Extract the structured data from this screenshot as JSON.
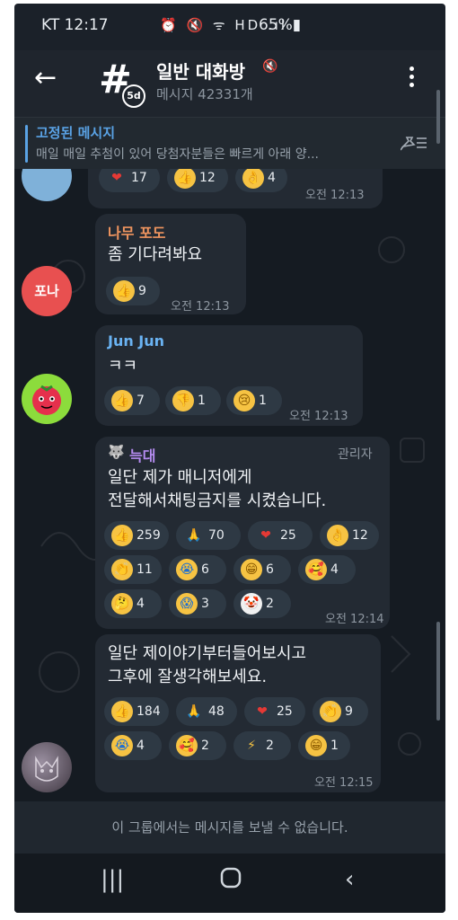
{
  "status": {
    "carrier_time": "KT 12:17",
    "icons": "⏰ 🔇 ᯤ HD .ıl",
    "battery": "65%▮"
  },
  "header": {
    "title": "일반 대화방",
    "badge": "5d",
    "subtitle": "메시지 42331개"
  },
  "pinned": {
    "title": "고정된 메시지",
    "text": "매일 매일 추첨이 있어 당첨자분들은 빠르게 아래 양..."
  },
  "messages": [
    {
      "reactions": [
        {
          "emoji": "heart",
          "count": "17"
        },
        {
          "emoji": "thumbs-up",
          "count": "12"
        },
        {
          "emoji": "ok-hand",
          "count": "4"
        }
      ],
      "time": "오전 12:13"
    },
    {
      "sender": "나무 포도",
      "text": "좀 기다려봐요",
      "avatar_label": "포나",
      "reactions": [
        {
          "emoji": "thumbs-up",
          "count": "9"
        }
      ],
      "time": "오전 12:13"
    },
    {
      "sender": "Jun Jun",
      "text": "ㅋㅋ",
      "reactions": [
        {
          "emoji": "thumbs-up",
          "count": "7"
        },
        {
          "emoji": "thumbs-down",
          "count": "1"
        },
        {
          "emoji": "crying",
          "count": "1"
        }
      ],
      "time": "오전 12:13"
    },
    {
      "sender": "늑대",
      "role": "관리자",
      "text_lines": [
        "일단 제가 매니저에게",
        "전달해서채팅금지를 시켰습니다."
      ],
      "reactions": [
        {
          "emoji": "thumbs-up",
          "count": "259"
        },
        {
          "emoji": "pray",
          "count": "70"
        },
        {
          "emoji": "heart",
          "count": "25"
        },
        {
          "emoji": "ok-hand",
          "count": "12"
        },
        {
          "emoji": "clap",
          "count": "11"
        },
        {
          "emoji": "sob",
          "count": "6"
        },
        {
          "emoji": "grin",
          "count": "6"
        },
        {
          "emoji": "hearts-face",
          "count": "4"
        },
        {
          "emoji": "thinking",
          "count": "4"
        },
        {
          "emoji": "scream",
          "count": "3"
        },
        {
          "emoji": "clown",
          "count": "2"
        }
      ],
      "time": "오전 12:14"
    },
    {
      "text_lines": [
        "일단 제이야기부터들어보시고",
        "그후에 잘생각해보세요."
      ],
      "reactions": [
        {
          "emoji": "thumbs-up",
          "count": "184"
        },
        {
          "emoji": "pray",
          "count": "48"
        },
        {
          "emoji": "heart",
          "count": "25"
        },
        {
          "emoji": "clap",
          "count": "9"
        },
        {
          "emoji": "sob",
          "count": "4"
        },
        {
          "emoji": "hearts-face",
          "count": "2"
        },
        {
          "emoji": "zap",
          "count": "2"
        },
        {
          "emoji": "grin",
          "count": "1"
        }
      ],
      "time": "오전 12:15"
    }
  ],
  "footer": {
    "notice": "이 그룹에서는 메시지를 보낼 수 없습니다."
  },
  "colors": {
    "background": "#1b2129",
    "bubble": "#232a33",
    "accent": "#5aa3e6",
    "sender_nama": "#f0955f",
    "sender_jun": "#6ab3f3",
    "sender_wolf": "#b58cf0"
  }
}
